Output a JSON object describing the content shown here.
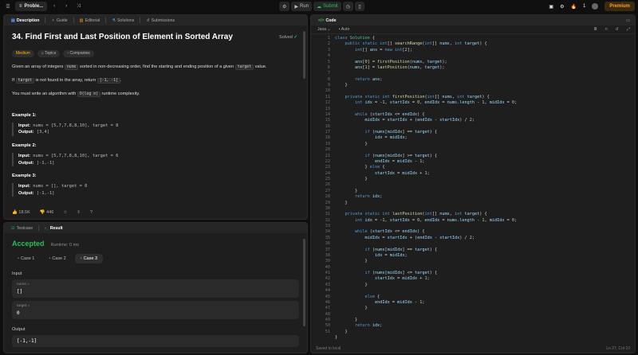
{
  "topbar": {
    "problem_title": "Proble...",
    "run_label": "Run",
    "submit_label": "Submit",
    "fire_count": "1",
    "premium_label": "Premium"
  },
  "desc_tabs": [
    "Description",
    "Guide",
    "Editorial",
    "Solutions",
    "Submissions"
  ],
  "problem": {
    "title": "34. Find First and Last Position of Element in Sorted Array",
    "solved": "Solved",
    "difficulty": "Medium",
    "topics": "Topics",
    "companies": "Companies",
    "p1a": "Given an array of integers ",
    "p1code1": "nums",
    "p1b": " sorted in non-decreasing order, find the starting and ending position of a given ",
    "p1code2": "target",
    "p1c": " value.",
    "p2a": "If ",
    "p2code1": "target",
    "p2b": " is not found in the array, return ",
    "p2code2": "[-1, -1]",
    "p2c": ".",
    "p3a": "You must write an algorithm with ",
    "p3code": "O(log n)",
    "p3b": " runtime complexity.",
    "examples": [
      {
        "heading": "Example 1:",
        "input_label": "Input:",
        "input": " nums = [5,7,7,8,8,10], target = 8",
        "output_label": "Output:",
        "output": " [3,4]"
      },
      {
        "heading": "Example 2:",
        "input_label": "Input:",
        "input": " nums = [5,7,7,8,8,10], target = 6",
        "output_label": "Output:",
        "output": " [-1,-1]"
      },
      {
        "heading": "Example 3:",
        "input_label": "Input:",
        "input": " nums = [], target = 0",
        "output_label": "Output:",
        "output": " [-1,-1]"
      }
    ],
    "likes": "18.5K",
    "dislikes": "446"
  },
  "result_tabs": [
    "Testcase",
    "Result"
  ],
  "result": {
    "status": "Accepted",
    "runtime": "Runtime: 0 ms",
    "cases": [
      "Case 1",
      "Case 2",
      "Case 3"
    ],
    "input_label": "Input",
    "nums_key": "nums =",
    "nums_val": "[]",
    "target_key": "target =",
    "target_val": "0",
    "output_label": "Output",
    "output_val": "[-1,-1]"
  },
  "code": {
    "tab": "Code",
    "language": "Java",
    "mode": "Auto",
    "saved": "Saved to local",
    "cursor": "Ln 27, Col 10",
    "line_count": 51
  },
  "colors": {
    "accent": "#ffa116",
    "success": "#2cbb5d"
  }
}
